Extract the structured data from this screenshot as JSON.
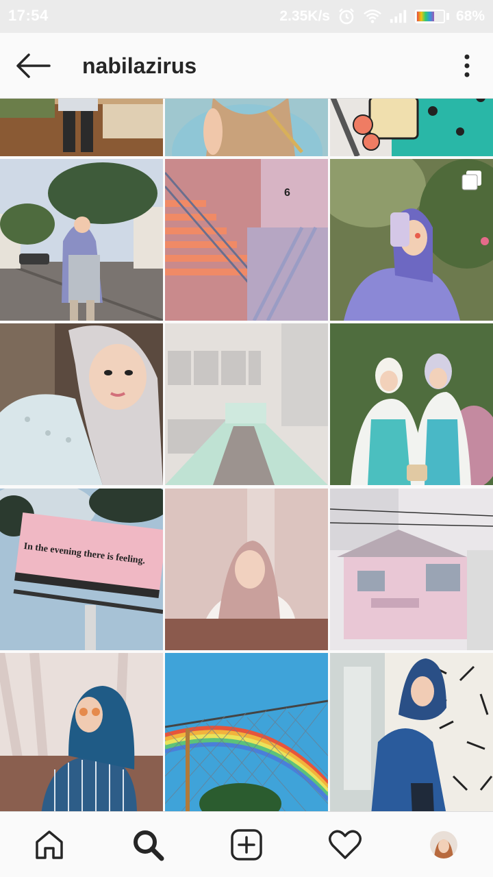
{
  "status_bar": {
    "time": "17:54",
    "network_speed": "2.35K/s",
    "battery_percent": "68%",
    "battery_level": 0.68,
    "icons": [
      "alarm-icon",
      "wifi-icon",
      "signal-icon",
      "battery-icon"
    ]
  },
  "header": {
    "title": "nabilazirus",
    "back_icon": "back-arrow-icon",
    "more_icon": "more-vertical-icon"
  },
  "grid": {
    "billboard_text": "In the evening there is feeling.",
    "apartment_number": "6",
    "multi_photo_badge_icon": "carousel-icon"
  },
  "bottom_nav": {
    "items": [
      "home-icon",
      "search-icon",
      "add-icon",
      "heart-icon",
      "profile-avatar"
    ]
  },
  "colors": {
    "background": "#fafafa",
    "text": "#262626",
    "divider": "#dbdbdb",
    "status_bar": "#ebebeb"
  }
}
